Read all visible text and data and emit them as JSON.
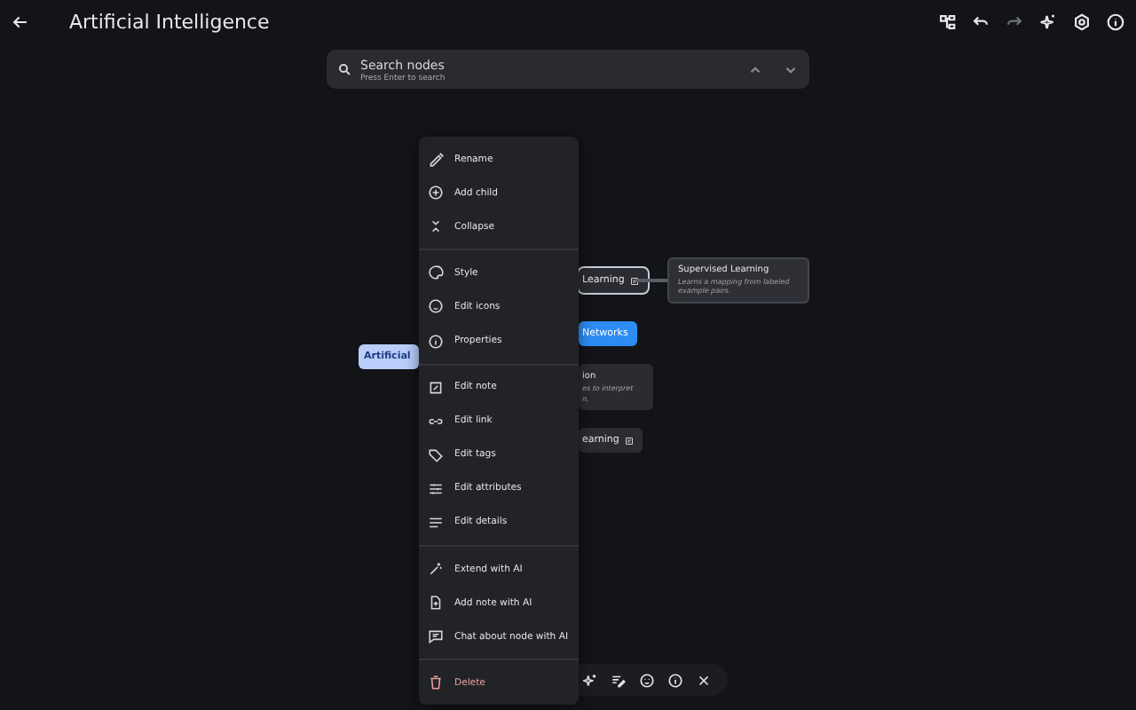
{
  "header": {
    "title": "Artificial Intelligence"
  },
  "search": {
    "placeholder": "Search nodes",
    "hint": "Press Enter to search"
  },
  "nodes": [
    {
      "kind": "root",
      "text": "Artificial"
    },
    {
      "kind": "plain",
      "text": "Learning",
      "selected": true,
      "note": true
    },
    {
      "kind": "accent",
      "text": "Networks",
      "selected": false,
      "note": false
    },
    {
      "kind": "card",
      "title": "ion",
      "lines": [
        "es to interpret",
        "n."
      ]
    },
    {
      "kind": "plain",
      "text": "earning",
      "selected": false,
      "note": true
    }
  ],
  "tooltip": {
    "title": "Supervised Learning",
    "text": "Learns a mapping from labeled example pairs."
  },
  "menu": [
    [
      {
        "label": "Rename",
        "kind": "normal"
      },
      {
        "label": "Add child",
        "kind": "normal"
      },
      {
        "label": "Collapse",
        "kind": "normal"
      }
    ],
    [
      {
        "label": "Style",
        "kind": "normal"
      },
      {
        "label": "Edit icons",
        "kind": "normal"
      },
      {
        "label": "Properties",
        "kind": "normal"
      }
    ],
    [
      {
        "label": "Edit note",
        "kind": "normal"
      },
      {
        "label": "Edit link",
        "kind": "normal"
      },
      {
        "label": "Edit tags",
        "kind": "normal"
      },
      {
        "label": "Edit attributes",
        "kind": "normal"
      },
      {
        "label": "Edit details",
        "kind": "normal"
      }
    ],
    [
      {
        "label": "Extend with AI",
        "kind": "normal"
      },
      {
        "label": "Add note with AI",
        "kind": "normal"
      },
      {
        "label": "Chat about node with AI",
        "kind": "normal"
      }
    ],
    [
      {
        "label": "Delete",
        "kind": "danger"
      }
    ]
  ]
}
